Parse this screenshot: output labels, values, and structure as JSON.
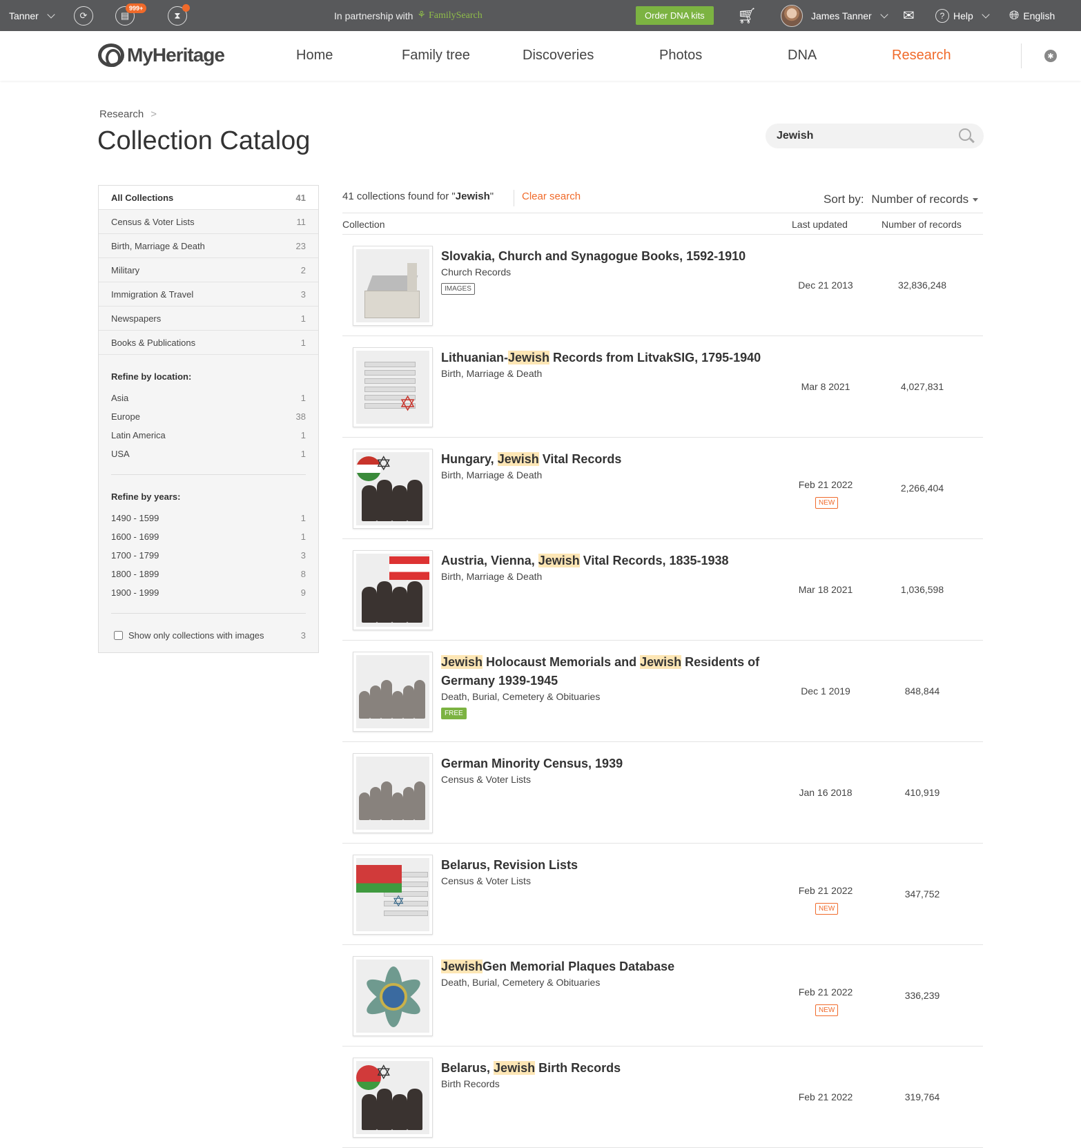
{
  "topbar": {
    "user_short": "Tanner",
    "notifications_badge": "999+",
    "partnership_text": "In partnership with",
    "partner_name": "FamilySearch",
    "order_dna_label": "Order DNA kits",
    "user_name": "James Tanner",
    "help_label": "Help",
    "language_label": "English",
    "colors": {
      "bar": "#58595b",
      "accent": "#f06a2a",
      "dna_button": "#7cb342"
    }
  },
  "nav": {
    "logo_text": "MyHeritage",
    "items": [
      {
        "label": "Home"
      },
      {
        "label": "Family tree"
      },
      {
        "label": "Discoveries"
      },
      {
        "label": "Photos"
      },
      {
        "label": "DNA"
      },
      {
        "label": "Research"
      }
    ],
    "active": "Research"
  },
  "header": {
    "breadcrumb": "Research",
    "breadcrumb_sep": ">",
    "title": "Collection Catalog",
    "search_value": "Jewish"
  },
  "sidebar": {
    "categories": [
      {
        "label": "All Collections",
        "count": "41"
      },
      {
        "label": "Census & Voter Lists",
        "count": "11"
      },
      {
        "label": "Birth, Marriage & Death",
        "count": "23"
      },
      {
        "label": "Military",
        "count": "2"
      },
      {
        "label": "Immigration & Travel",
        "count": "3"
      },
      {
        "label": "Newspapers",
        "count": "1"
      },
      {
        "label": "Books & Publications",
        "count": "1"
      }
    ],
    "location_heading": "Refine by location:",
    "locations": [
      {
        "label": "Asia",
        "count": "1"
      },
      {
        "label": "Europe",
        "count": "38"
      },
      {
        "label": "Latin America",
        "count": "1"
      },
      {
        "label": "USA",
        "count": "1"
      }
    ],
    "years_heading": "Refine by years:",
    "years": [
      {
        "label": "1490 - 1599",
        "count": "1"
      },
      {
        "label": "1600 - 1699",
        "count": "1"
      },
      {
        "label": "1700 - 1799",
        "count": "3"
      },
      {
        "label": "1800 - 1899",
        "count": "8"
      },
      {
        "label": "1900 - 1999",
        "count": "9"
      }
    ],
    "images_only_label": "Show only collections with images",
    "images_only_count": "3"
  },
  "results": {
    "count_text": "41 collections found for \"",
    "query": "Jewish",
    "count_text_end": "\"",
    "clear_label": "Clear search",
    "sort_label": "Sort by:",
    "sort_value": "Number of records",
    "col_collection": "Collection",
    "col_updated": "Last updated",
    "col_records": "Number of records",
    "rows": [
      {
        "title_parts": [
          "Slovakia, Church and Synagogue Books, 1592-1910"
        ],
        "category": "Church Records",
        "tag": "IMAGES",
        "date": "Dec 21 2013",
        "new": "",
        "records": "32,836,248"
      },
      {
        "title_parts": [
          "Lithuanian-",
          "Jewish",
          " Records from LitvakSIG, 1795-1940"
        ],
        "category": "Birth, Marriage & Death",
        "tag": "",
        "date": "Mar 8 2021",
        "new": "",
        "records": "4,027,831"
      },
      {
        "title_parts": [
          "Hungary, ",
          "Jewish",
          " Vital Records"
        ],
        "category": "Birth, Marriage & Death",
        "tag": "",
        "date": "Feb 21 2022",
        "new": "NEW",
        "records": "2,266,404"
      },
      {
        "title_parts": [
          "Austria, Vienna, ",
          "Jewish",
          " Vital Records, 1835-1938"
        ],
        "category": "Birth, Marriage & Death",
        "tag": "",
        "date": "Mar 18 2021",
        "new": "",
        "records": "1,036,598"
      },
      {
        "title_parts": [
          "",
          "Jewish",
          " Holocaust Memorials and ",
          "Jewish",
          " Residents of Germany 1939-1945"
        ],
        "category": "Death, Burial, Cemetery & Obituaries",
        "tag": "FREE",
        "date": "Dec 1 2019",
        "new": "",
        "records": "848,844"
      },
      {
        "title_parts": [
          "German Minority Census, 1939"
        ],
        "category": "Census & Voter Lists",
        "tag": "",
        "date": "Jan 16 2018",
        "new": "",
        "records": "410,919"
      },
      {
        "title_parts": [
          "Belarus, Revision Lists"
        ],
        "category": "Census & Voter Lists",
        "tag": "",
        "date": "Feb 21 2022",
        "new": "NEW",
        "records": "347,752"
      },
      {
        "title_parts": [
          "",
          "Jewish",
          "Gen Memorial Plaques Database"
        ],
        "category": "Death, Burial, Cemetery & Obituaries",
        "tag": "",
        "date": "Feb 21 2022",
        "new": "NEW",
        "records": "336,239"
      },
      {
        "title_parts": [
          "Belarus, ",
          "Jewish",
          " Birth Records"
        ],
        "category": "Birth Records",
        "tag": "",
        "date": "Feb 21 2022",
        "new": "",
        "records": "319,764"
      }
    ]
  }
}
